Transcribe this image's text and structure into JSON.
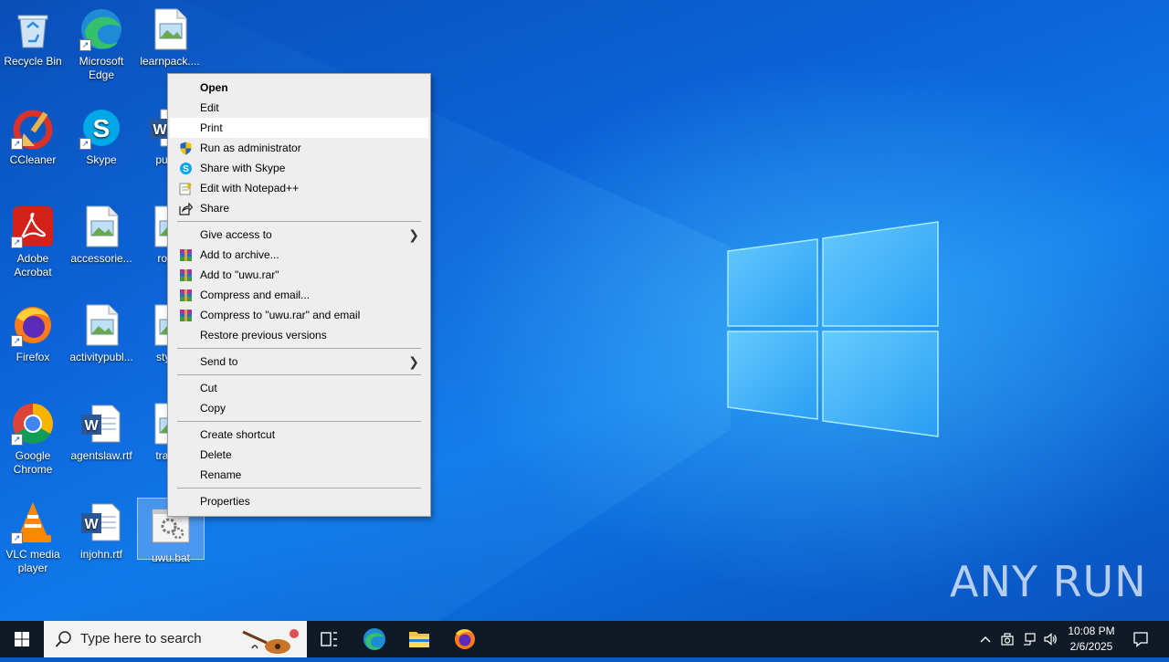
{
  "desktop_icons": [
    {
      "label": "Recycle Bin",
      "icon": "recycle-bin-icon"
    },
    {
      "label": "Microsoft Edge",
      "icon": "edge-icon"
    },
    {
      "label": "learnpack....",
      "icon": "image-file-icon"
    },
    {
      "label": "CCleaner",
      "icon": "ccleaner-icon"
    },
    {
      "label": "Skype",
      "icon": "skype-icon"
    },
    {
      "label": "publis",
      "icon": "word-doc-icon"
    },
    {
      "label": "Adobe Acrobat",
      "icon": "acrobat-icon"
    },
    {
      "label": "accessorie...",
      "icon": "image-file-icon"
    },
    {
      "label": "room",
      "icon": "image-file-icon"
    },
    {
      "label": "Firefox",
      "icon": "firefox-icon"
    },
    {
      "label": "activitypubl...",
      "icon": "image-file-icon"
    },
    {
      "label": "styleil",
      "icon": "image-file-icon"
    },
    {
      "label": "Google Chrome",
      "icon": "chrome-icon"
    },
    {
      "label": "agentslaw.rtf",
      "icon": "word-doc-icon"
    },
    {
      "label": "trader",
      "icon": "image-file-icon"
    },
    {
      "label": "VLC media player",
      "icon": "vlc-icon"
    },
    {
      "label": "injohn.rtf",
      "icon": "word-doc-icon"
    },
    {
      "label": "uwu.bat",
      "icon": "batch-file-icon"
    }
  ],
  "context_menu": {
    "items": [
      {
        "label": "Open"
      },
      {
        "label": "Edit"
      },
      {
        "label": "Print"
      },
      {
        "label": "Run as administrator"
      },
      {
        "label": "Share with Skype"
      },
      {
        "label": "Edit with Notepad++"
      },
      {
        "label": "Share"
      },
      {
        "label": "Give access to"
      },
      {
        "label": "Add to archive..."
      },
      {
        "label": "Add to \"uwu.rar\""
      },
      {
        "label": "Compress and email..."
      },
      {
        "label": "Compress to \"uwu.rar\" and email"
      },
      {
        "label": "Restore previous versions"
      },
      {
        "label": "Send to"
      },
      {
        "label": "Cut"
      },
      {
        "label": "Copy"
      },
      {
        "label": "Create shortcut"
      },
      {
        "label": "Delete"
      },
      {
        "label": "Rename"
      },
      {
        "label": "Properties"
      }
    ]
  },
  "taskbar": {
    "search_placeholder": "Type here to search",
    "time": "10:08 PM",
    "date": "2/6/2025"
  },
  "watermark": "ANY RUN"
}
